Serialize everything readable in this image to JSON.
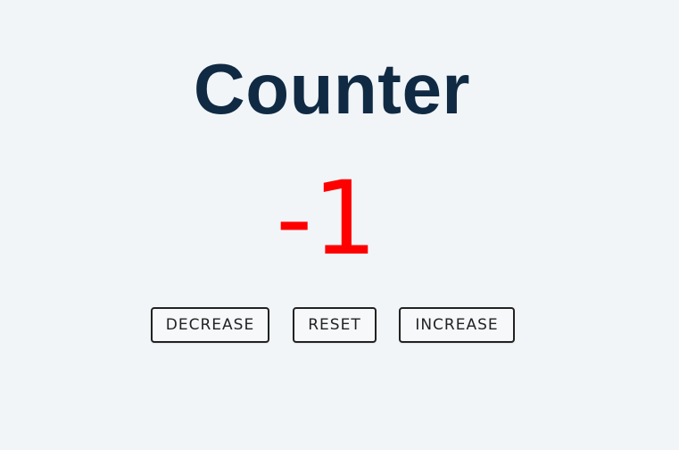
{
  "app": {
    "title": "Counter"
  },
  "counter": {
    "value": "-1",
    "value_color": "#ff0000"
  },
  "buttons": {
    "decrease_label": "DECREASE",
    "reset_label": "RESET",
    "increase_label": "INCREASE"
  },
  "colors": {
    "background": "#f1f5f8",
    "title": "#102a43",
    "button_border": "#222222"
  }
}
